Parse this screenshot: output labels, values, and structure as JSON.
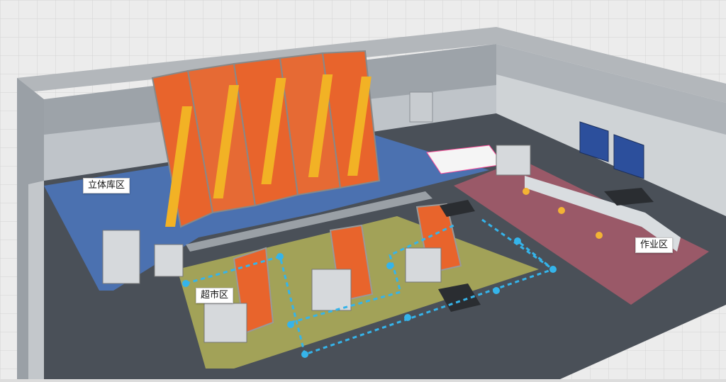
{
  "scene": {
    "labels": {
      "warehouse_zone": "立体库区",
      "supermarket_zone": "超市区",
      "work_zone": "作业区"
    },
    "colors": {
      "ground_tile": "#e9e9e9",
      "outer_wall": "#a9adb1",
      "inner_wall": "#c7cbcf",
      "floor": "#4a5058",
      "warehouse_zone": "#4b77c0",
      "supermarket_zone": "#b8b659",
      "work_zone": "#a85a6b",
      "rack_shelf": "#e8642c",
      "stacker_crane": "#f2b225",
      "agv_path": "#35b4ea",
      "door": "#2c4f9c"
    },
    "icons": {
      "door": "roll-up-door-icon",
      "agv": "agv-robot-icon",
      "workstation": "workstation-machine-icon",
      "operator": "worker-icon",
      "rack": "storage-rack-icon",
      "conveyor": "conveyor-belt-icon"
    }
  }
}
